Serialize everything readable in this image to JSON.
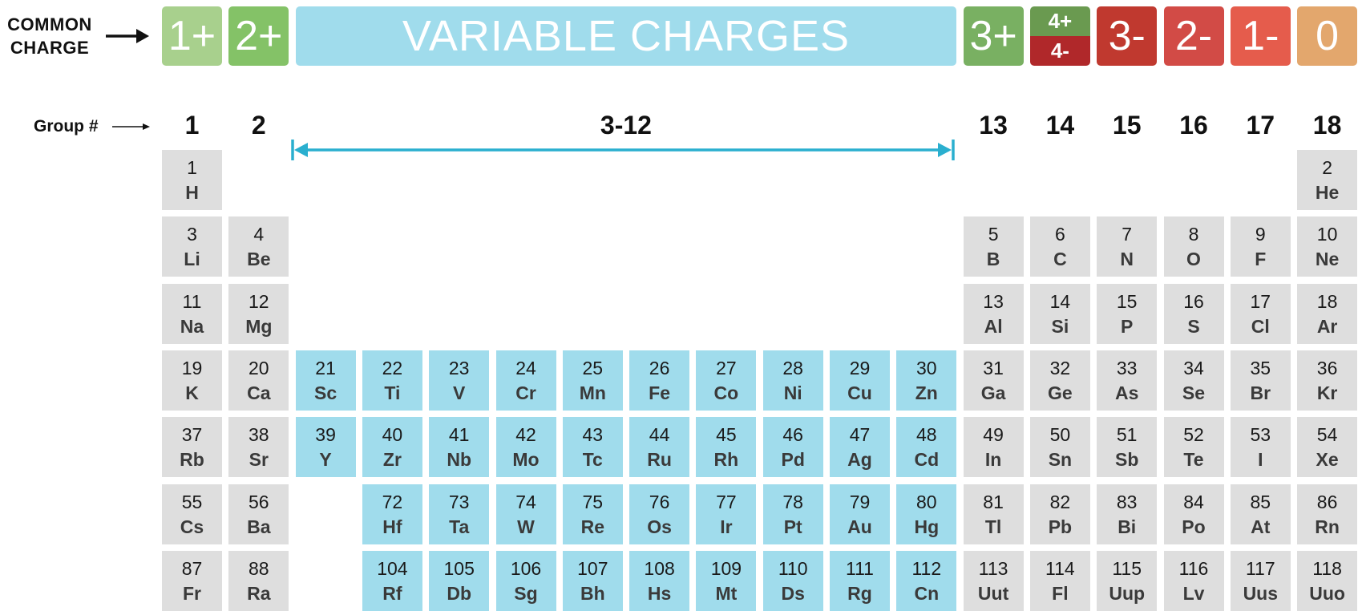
{
  "header": {
    "common_charge_label": [
      "COMMON",
      "CHARGE"
    ],
    "group_label": "Group #",
    "range_label": "3-12"
  },
  "charges": [
    {
      "label": "1+",
      "columns": [
        1
      ],
      "color": "#a8d08d"
    },
    {
      "label": "2+",
      "columns": [
        2
      ],
      "color": "#84c267"
    },
    {
      "label": "VARIABLE CHARGES",
      "columns": [
        3,
        12
      ],
      "color": "#a0dcec"
    },
    {
      "label": "3+",
      "columns": [
        13
      ],
      "color": "#79b062"
    },
    {
      "label_top": "4+",
      "label_bottom": "4-",
      "columns": [
        14
      ],
      "color_top": "#6a9a50",
      "color_bottom": "#b0282a"
    },
    {
      "label": "3-",
      "columns": [
        15
      ],
      "color": "#c0392f"
    },
    {
      "label": "2-",
      "columns": [
        16
      ],
      "color": "#d24b46"
    },
    {
      "label": "1-",
      "columns": [
        17
      ],
      "color": "#e55c4c"
    },
    {
      "label": "0",
      "columns": [
        18
      ],
      "color": "#e3a76d"
    }
  ],
  "groups": [
    {
      "label": "1",
      "column": 1
    },
    {
      "label": "2",
      "column": 2
    },
    {
      "label": "3-12",
      "column": 0
    },
    {
      "label": "13",
      "column": 13
    },
    {
      "label": "14",
      "column": 14
    },
    {
      "label": "15",
      "column": 15
    },
    {
      "label": "16",
      "column": 16
    },
    {
      "label": "17",
      "column": 17
    },
    {
      "label": "18",
      "column": 18
    }
  ],
  "colors": {
    "main_group": "#dedede",
    "transition_metal": "#a0dcec",
    "range_arrow": "#2aafcf"
  },
  "elements": [
    {
      "n": "1",
      "s": "H",
      "row": 1,
      "col": 1
    },
    {
      "n": "2",
      "s": "He",
      "row": 1,
      "col": 18
    },
    {
      "n": "3",
      "s": "Li",
      "row": 2,
      "col": 1
    },
    {
      "n": "4",
      "s": "Be",
      "row": 2,
      "col": 2
    },
    {
      "n": "5",
      "s": "B",
      "row": 2,
      "col": 13
    },
    {
      "n": "6",
      "s": "C",
      "row": 2,
      "col": 14
    },
    {
      "n": "7",
      "s": "N",
      "row": 2,
      "col": 15
    },
    {
      "n": "8",
      "s": "O",
      "row": 2,
      "col": 16
    },
    {
      "n": "9",
      "s": "F",
      "row": 2,
      "col": 17
    },
    {
      "n": "10",
      "s": "Ne",
      "row": 2,
      "col": 18
    },
    {
      "n": "11",
      "s": "Na",
      "row": 3,
      "col": 1
    },
    {
      "n": "12",
      "s": "Mg",
      "row": 3,
      "col": 2
    },
    {
      "n": "13",
      "s": "Al",
      "row": 3,
      "col": 13
    },
    {
      "n": "14",
      "s": "Si",
      "row": 3,
      "col": 14
    },
    {
      "n": "15",
      "s": "P",
      "row": 3,
      "col": 15
    },
    {
      "n": "16",
      "s": "S",
      "row": 3,
      "col": 16
    },
    {
      "n": "17",
      "s": "Cl",
      "row": 3,
      "col": 17
    },
    {
      "n": "18",
      "s": "Ar",
      "row": 3,
      "col": 18
    },
    {
      "n": "19",
      "s": "K",
      "row": 4,
      "col": 1
    },
    {
      "n": "20",
      "s": "Ca",
      "row": 4,
      "col": 2
    },
    {
      "n": "21",
      "s": "Sc",
      "row": 4,
      "col": 3
    },
    {
      "n": "22",
      "s": "Ti",
      "row": 4,
      "col": 4
    },
    {
      "n": "23",
      "s": "V",
      "row": 4,
      "col": 5
    },
    {
      "n": "24",
      "s": "Cr",
      "row": 4,
      "col": 6
    },
    {
      "n": "25",
      "s": "Mn",
      "row": 4,
      "col": 7
    },
    {
      "n": "26",
      "s": "Fe",
      "row": 4,
      "col": 8
    },
    {
      "n": "27",
      "s": "Co",
      "row": 4,
      "col": 9
    },
    {
      "n": "28",
      "s": "Ni",
      "row": 4,
      "col": 10
    },
    {
      "n": "29",
      "s": "Cu",
      "row": 4,
      "col": 11
    },
    {
      "n": "30",
      "s": "Zn",
      "row": 4,
      "col": 12
    },
    {
      "n": "31",
      "s": "Ga",
      "row": 4,
      "col": 13
    },
    {
      "n": "32",
      "s": "Ge",
      "row": 4,
      "col": 14
    },
    {
      "n": "33",
      "s": "As",
      "row": 4,
      "col": 15
    },
    {
      "n": "34",
      "s": "Se",
      "row": 4,
      "col": 16
    },
    {
      "n": "35",
      "s": "Br",
      "row": 4,
      "col": 17
    },
    {
      "n": "36",
      "s": "Kr",
      "row": 4,
      "col": 18
    },
    {
      "n": "37",
      "s": "Rb",
      "row": 5,
      "col": 1
    },
    {
      "n": "38",
      "s": "Sr",
      "row": 5,
      "col": 2
    },
    {
      "n": "39",
      "s": "Y",
      "row": 5,
      "col": 3
    },
    {
      "n": "40",
      "s": "Zr",
      "row": 5,
      "col": 4
    },
    {
      "n": "41",
      "s": "Nb",
      "row": 5,
      "col": 5
    },
    {
      "n": "42",
      "s": "Mo",
      "row": 5,
      "col": 6
    },
    {
      "n": "43",
      "s": "Tc",
      "row": 5,
      "col": 7
    },
    {
      "n": "44",
      "s": "Ru",
      "row": 5,
      "col": 8
    },
    {
      "n": "45",
      "s": "Rh",
      "row": 5,
      "col": 9
    },
    {
      "n": "46",
      "s": "Pd",
      "row": 5,
      "col": 10
    },
    {
      "n": "47",
      "s": "Ag",
      "row": 5,
      "col": 11
    },
    {
      "n": "48",
      "s": "Cd",
      "row": 5,
      "col": 12
    },
    {
      "n": "49",
      "s": "In",
      "row": 5,
      "col": 13
    },
    {
      "n": "50",
      "s": "Sn",
      "row": 5,
      "col": 14
    },
    {
      "n": "51",
      "s": "Sb",
      "row": 5,
      "col": 15
    },
    {
      "n": "52",
      "s": "Te",
      "row": 5,
      "col": 16
    },
    {
      "n": "53",
      "s": "I",
      "row": 5,
      "col": 17
    },
    {
      "n": "54",
      "s": "Xe",
      "row": 5,
      "col": 18
    },
    {
      "n": "55",
      "s": "Cs",
      "row": 6,
      "col": 1
    },
    {
      "n": "56",
      "s": "Ba",
      "row": 6,
      "col": 2
    },
    {
      "n": "72",
      "s": "Hf",
      "row": 6,
      "col": 4
    },
    {
      "n": "73",
      "s": "Ta",
      "row": 6,
      "col": 5
    },
    {
      "n": "74",
      "s": "W",
      "row": 6,
      "col": 6
    },
    {
      "n": "75",
      "s": "Re",
      "row": 6,
      "col": 7
    },
    {
      "n": "76",
      "s": "Os",
      "row": 6,
      "col": 8
    },
    {
      "n": "77",
      "s": "Ir",
      "row": 6,
      "col": 9
    },
    {
      "n": "78",
      "s": "Pt",
      "row": 6,
      "col": 10
    },
    {
      "n": "79",
      "s": "Au",
      "row": 6,
      "col": 11
    },
    {
      "n": "80",
      "s": "Hg",
      "row": 6,
      "col": 12
    },
    {
      "n": "81",
      "s": "Tl",
      "row": 6,
      "col": 13
    },
    {
      "n": "82",
      "s": "Pb",
      "row": 6,
      "col": 14
    },
    {
      "n": "83",
      "s": "Bi",
      "row": 6,
      "col": 15
    },
    {
      "n": "84",
      "s": "Po",
      "row": 6,
      "col": 16
    },
    {
      "n": "85",
      "s": "At",
      "row": 6,
      "col": 17
    },
    {
      "n": "86",
      "s": "Rn",
      "row": 6,
      "col": 18
    },
    {
      "n": "87",
      "s": "Fr",
      "row": 7,
      "col": 1
    },
    {
      "n": "88",
      "s": "Ra",
      "row": 7,
      "col": 2
    },
    {
      "n": "104",
      "s": "Rf",
      "row": 7,
      "col": 4
    },
    {
      "n": "105",
      "s": "Db",
      "row": 7,
      "col": 5
    },
    {
      "n": "106",
      "s": "Sg",
      "row": 7,
      "col": 6
    },
    {
      "n": "107",
      "s": "Bh",
      "row": 7,
      "col": 7
    },
    {
      "n": "108",
      "s": "Hs",
      "row": 7,
      "col": 8
    },
    {
      "n": "109",
      "s": "Mt",
      "row": 7,
      "col": 9
    },
    {
      "n": "110",
      "s": "Ds",
      "row": 7,
      "col": 10
    },
    {
      "n": "111",
      "s": "Rg",
      "row": 7,
      "col": 11
    },
    {
      "n": "112",
      "s": "Cn",
      "row": 7,
      "col": 12
    },
    {
      "n": "113",
      "s": "Uut",
      "row": 7,
      "col": 13
    },
    {
      "n": "114",
      "s": "Fl",
      "row": 7,
      "col": 14
    },
    {
      "n": "115",
      "s": "Uup",
      "row": 7,
      "col": 15
    },
    {
      "n": "116",
      "s": "Lv",
      "row": 7,
      "col": 16
    },
    {
      "n": "117",
      "s": "Uus",
      "row": 7,
      "col": 17
    },
    {
      "n": "118",
      "s": "Uuo",
      "row": 7,
      "col": 18
    }
  ]
}
